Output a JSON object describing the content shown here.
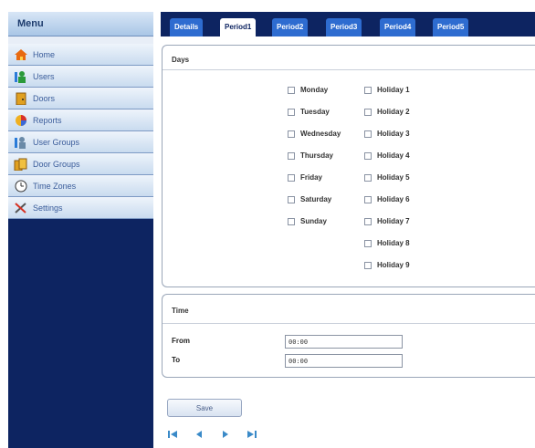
{
  "sidebar": {
    "title": "Menu",
    "items": [
      {
        "label": "Home",
        "icon": "home-icon"
      },
      {
        "label": "Users",
        "icon": "users-icon"
      },
      {
        "label": "Doors",
        "icon": "door-icon"
      },
      {
        "label": "Reports",
        "icon": "reports-icon"
      },
      {
        "label": "User Groups",
        "icon": "user-groups-icon"
      },
      {
        "label": "Door Groups",
        "icon": "door-groups-icon"
      },
      {
        "label": "Time Zones",
        "icon": "clock-icon"
      },
      {
        "label": "Settings",
        "icon": "settings-icon"
      }
    ]
  },
  "tabs": [
    {
      "label": "Details"
    },
    {
      "label": "Period1",
      "active": true
    },
    {
      "label": "Period2"
    },
    {
      "label": "Period3"
    },
    {
      "label": "Period4"
    },
    {
      "label": "Period5"
    }
  ],
  "days": {
    "title": "Days",
    "weekdays": [
      "Monday",
      "Tuesday",
      "Wednesday",
      "Thursday",
      "Friday",
      "Saturday",
      "Sunday"
    ],
    "holidays": [
      "Holiday 1",
      "Holiday 2",
      "Holiday 3",
      "Holiday 4",
      "Holiday 5",
      "Holiday 6",
      "Holiday 7",
      "Holiday 8",
      "Holiday 9"
    ]
  },
  "time": {
    "title": "Time",
    "from_label": "From",
    "from_value": "00:00",
    "to_label": "To",
    "to_value": "00:00"
  },
  "actions": {
    "save_label": "Save"
  },
  "colors": {
    "navy": "#0d2461",
    "tab_blue": "#2e6cd0",
    "menu_text": "#3a5c9a"
  }
}
